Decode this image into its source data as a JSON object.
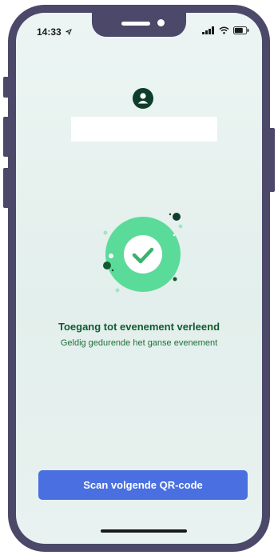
{
  "status_bar": {
    "time": "14:33",
    "icons": [
      "location-arrow-icon",
      "signal-icon",
      "wifi-icon",
      "battery-icon"
    ]
  },
  "profile": {
    "avatar_icon": "person-icon",
    "name": ""
  },
  "result": {
    "icon": "checkmark-icon",
    "title": "Toegang tot evenement verleend",
    "subtitle": "Geldig gedurende het ganse evenement"
  },
  "actions": {
    "scan_next_label": "Scan volgende QR-code"
  },
  "colors": {
    "frame": "#4b4869",
    "success_green": "#5bdb9a",
    "title_green": "#0f5a2e",
    "button_blue": "#4a6fe0"
  }
}
